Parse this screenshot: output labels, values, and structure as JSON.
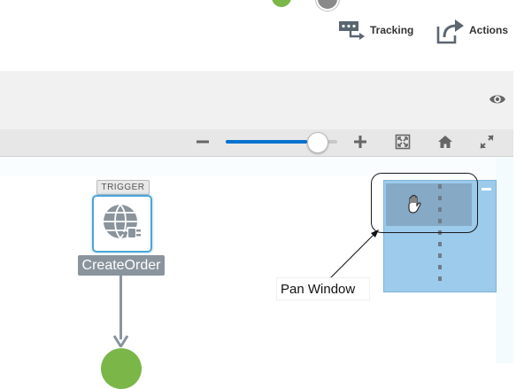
{
  "toolbar": {
    "tracking_label": "Tracking",
    "actions_label": "Actions"
  },
  "zoom": {
    "level_fraction": 0.82
  },
  "icons": {
    "eye": "eye-icon",
    "zoom_out": "minus-icon",
    "zoom_in": "plus-icon",
    "fit": "fit-to-screen-icon",
    "home": "home-icon",
    "expand": "expand-icon",
    "node": "globe-plug-icon",
    "hand": "hand-grab-icon"
  },
  "flow": {
    "trigger_tag": "TRIGGER",
    "node_label": "CreateOrder"
  },
  "callout": {
    "label": "Pan Window"
  },
  "colors": {
    "accent_blue": "#0572ce",
    "node_border": "#4ba5d9",
    "label_bg": "#8a949d",
    "minimap_bg": "#9ccbec",
    "success_green": "#7ab648"
  }
}
